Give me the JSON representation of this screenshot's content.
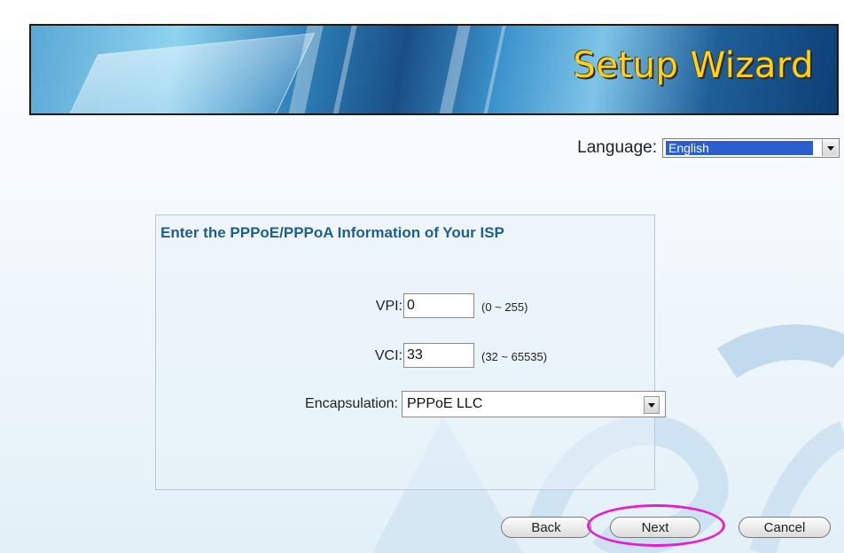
{
  "banner": {
    "title": "Setup Wizard"
  },
  "language": {
    "label": "Language:",
    "selected": "English"
  },
  "panel": {
    "title": "Enter the PPPoE/PPPoA Information of Your ISP",
    "vpi": {
      "label": "VPI:",
      "value": "0",
      "range": "(0 ~ 255)"
    },
    "vci": {
      "label": "VCI:",
      "value": "33",
      "range": "(32 ~ 65535)"
    },
    "encapsulation": {
      "label": "Encapsulation:",
      "selected": "PPPoE LLC"
    }
  },
  "buttons": {
    "back": "Back",
    "next": "Next",
    "cancel": "Cancel"
  },
  "colors": {
    "title_yellow": "#ffd21a",
    "panel_title": "#1f5f8b",
    "highlight": "#e61fd0",
    "selection": "#2b5fd0"
  }
}
